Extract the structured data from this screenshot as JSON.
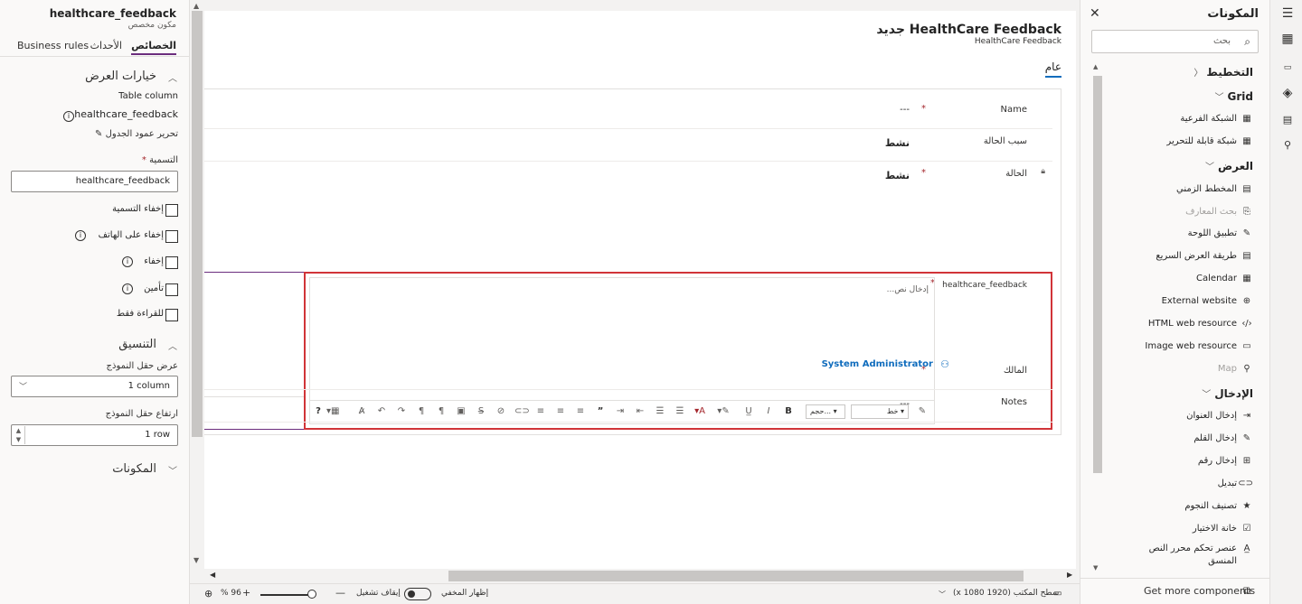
{
  "props": {
    "component_name": "healthcare_feedback",
    "component_type": "مكون مخصص",
    "tabs": [
      "الخصائص",
      "الأحداث",
      "Business rules"
    ],
    "display_section": "خيارات العرض",
    "table_column_label": "Table column",
    "table_column_value": "healthcare_feedback",
    "edit_column": "تحرير عمود الجدول",
    "label_title": "التسمية",
    "label_value": "healthcare_feedback",
    "checkboxes": [
      "إخفاء التسمية",
      "إخفاء على الهاتف",
      "إخفاء",
      "تأمين",
      "للقراءة فقط"
    ],
    "format_section": "التنسيق",
    "width_label": "عرض حقل النموذج",
    "width_value": "1 column",
    "height_label": "ارتفاع حقل النموذج",
    "height_value": "1 row",
    "components_section": "المكونات"
  },
  "form": {
    "title": "HealthCare Feedback جديد",
    "subtitle": "HealthCare Feedback",
    "tab": "عام",
    "rows": [
      {
        "label": "Name",
        "required": true,
        "value": "---"
      },
      {
        "label": "سبب الحالة",
        "required": false,
        "value": "نشط"
      },
      {
        "label": "الحالة",
        "required": true,
        "value": "نشط"
      }
    ],
    "rte_label": "healthcare_feedback",
    "rte_placeholder": "إدخال نص...",
    "font_select": "خط",
    "size_select": "حجم...",
    "owner_label": "المالك",
    "owner_value": "System Administrator",
    "notes_label": "Notes",
    "notes_value": "---"
  },
  "components": {
    "title": "المكونات",
    "search_placeholder": "بحث",
    "groups": {
      "layout": "التخطيط",
      "grid": "Grid",
      "display": "العرض",
      "input": "الإدخال"
    },
    "grid_items": [
      "الشبكة الفرعية",
      "شبكة قابلة للتحرير"
    ],
    "display_items": [
      "المخطط الزمني",
      "بحث المعارف",
      "تطبيق اللوحة",
      "طريقة العرض السريع",
      "Calendar",
      "External website",
      "HTML web resource",
      "Image web resource",
      "Map"
    ],
    "input_items": [
      "إدخال العنوان",
      "إدخال القلم",
      "إدخال رقم",
      "تبديل",
      "تصنيف النجوم",
      "خانة الاختيار",
      "عنصر تحكم محرر النص",
      "المنسق"
    ],
    "more": "Get more components"
  },
  "status": {
    "device": "سطح المكتب (1920 x 1080)",
    "show_hidden": "إظهار المخفي",
    "toggle_label": "إيقاف تشغيل",
    "zoom": "96 %"
  },
  "colors": {
    "accent_purple": "#6b2d7d",
    "selection_red": "#d13438",
    "link_blue": "#0f6cbd",
    "required_red": "#a4262c"
  }
}
